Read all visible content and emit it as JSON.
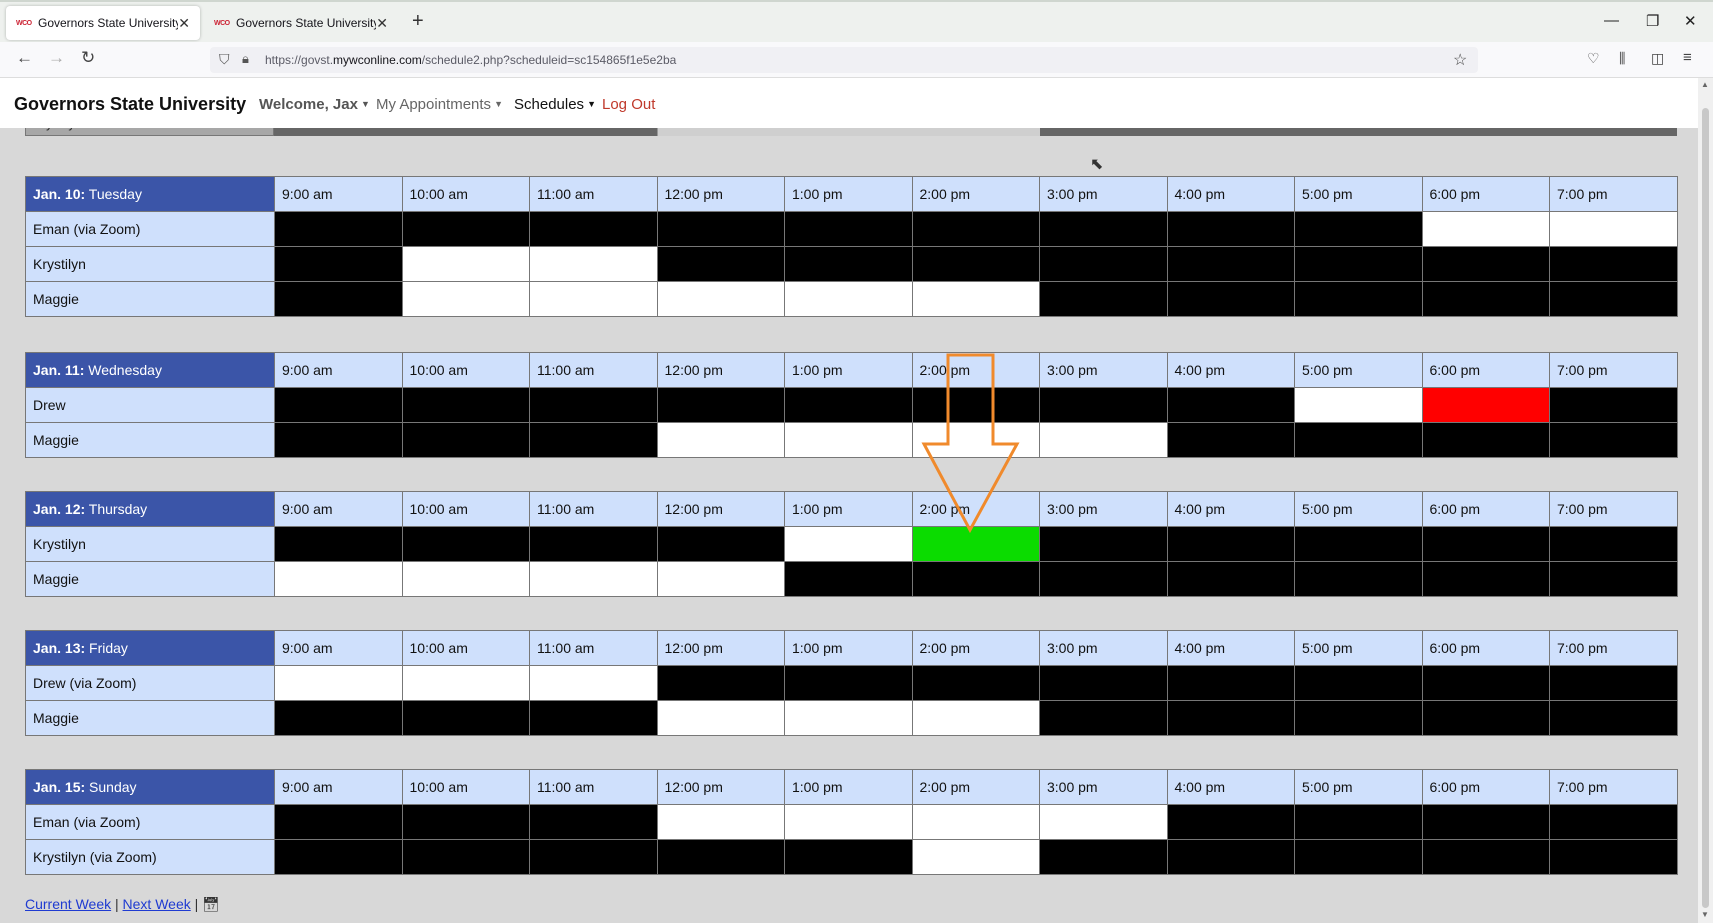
{
  "browser": {
    "tabs": [
      {
        "favicon": "WCO",
        "title": "Governors State University"
      },
      {
        "favicon": "WCO",
        "title": "Governors State University"
      }
    ],
    "url_prefix": "https://govst.",
    "url_domain": "mywconline.com",
    "url_rest": "/schedule2.php?scheduleid=sc154865f1e5e2ba"
  },
  "site": {
    "brand": "Governors State University",
    "welcome": "Welcome, Jax",
    "appointments": "My Appointments",
    "schedules": "Schedules",
    "logout": "Log Out"
  },
  "partial_row_name": "Krystilyn",
  "times": [
    "9:00 am",
    "10:00 am",
    "11:00 am",
    "12:00 pm",
    "1:00 pm",
    "2:00 pm",
    "3:00 pm",
    "4:00 pm",
    "5:00 pm",
    "6:00 pm",
    "7:00 pm"
  ],
  "legend": {
    "o": "open slot",
    "x": "unavailable",
    "r": "booked (red)",
    "g": "selected (green)"
  },
  "days": [
    {
      "date": "Jan. 10:",
      "weekday": "Tuesday",
      "rows": [
        {
          "name": "Eman (via Zoom)",
          "slots": "xxxxxxxxxoo"
        },
        {
          "name": "Krystilyn",
          "slots": "xooxxxxxxxx"
        },
        {
          "name": "Maggie",
          "slots": "xoooooxxxxx"
        }
      ]
    },
    {
      "date": "Jan. 11:",
      "weekday": "Wednesday",
      "rows": [
        {
          "name": "Drew",
          "slots": "xxxxxxxxorx"
        },
        {
          "name": "Maggie",
          "slots": "xxxooooxxxx"
        }
      ]
    },
    {
      "date": "Jan. 12:",
      "weekday": "Thursday",
      "rows": [
        {
          "name": "Krystilyn",
          "slots": "xxxxogxxxxx"
        },
        {
          "name": "Maggie",
          "slots": "ooooxxxxxxx"
        }
      ]
    },
    {
      "date": "Jan. 13:",
      "weekday": "Friday",
      "rows": [
        {
          "name": "Drew (via Zoom)",
          "slots": "oooxxxxxxxx"
        },
        {
          "name": "Maggie",
          "slots": "xxxoooxxxxx"
        }
      ]
    },
    {
      "date": "Jan. 15:",
      "weekday": "Sunday",
      "rows": [
        {
          "name": "Eman (via Zoom)",
          "slots": "xxxooooxxxx"
        },
        {
          "name": "Krystilyn (via Zoom)",
          "slots": "xxxxxoxxxxx"
        }
      ]
    }
  ],
  "footer": {
    "current": "Current Week",
    "next": "Next Week",
    "sep": "|"
  },
  "colors": {
    "header": "#3b55a8",
    "cell": "#cfe0fc",
    "red": "#ff0000",
    "green": "#0bdc00",
    "arrow": "#f08a2c"
  }
}
